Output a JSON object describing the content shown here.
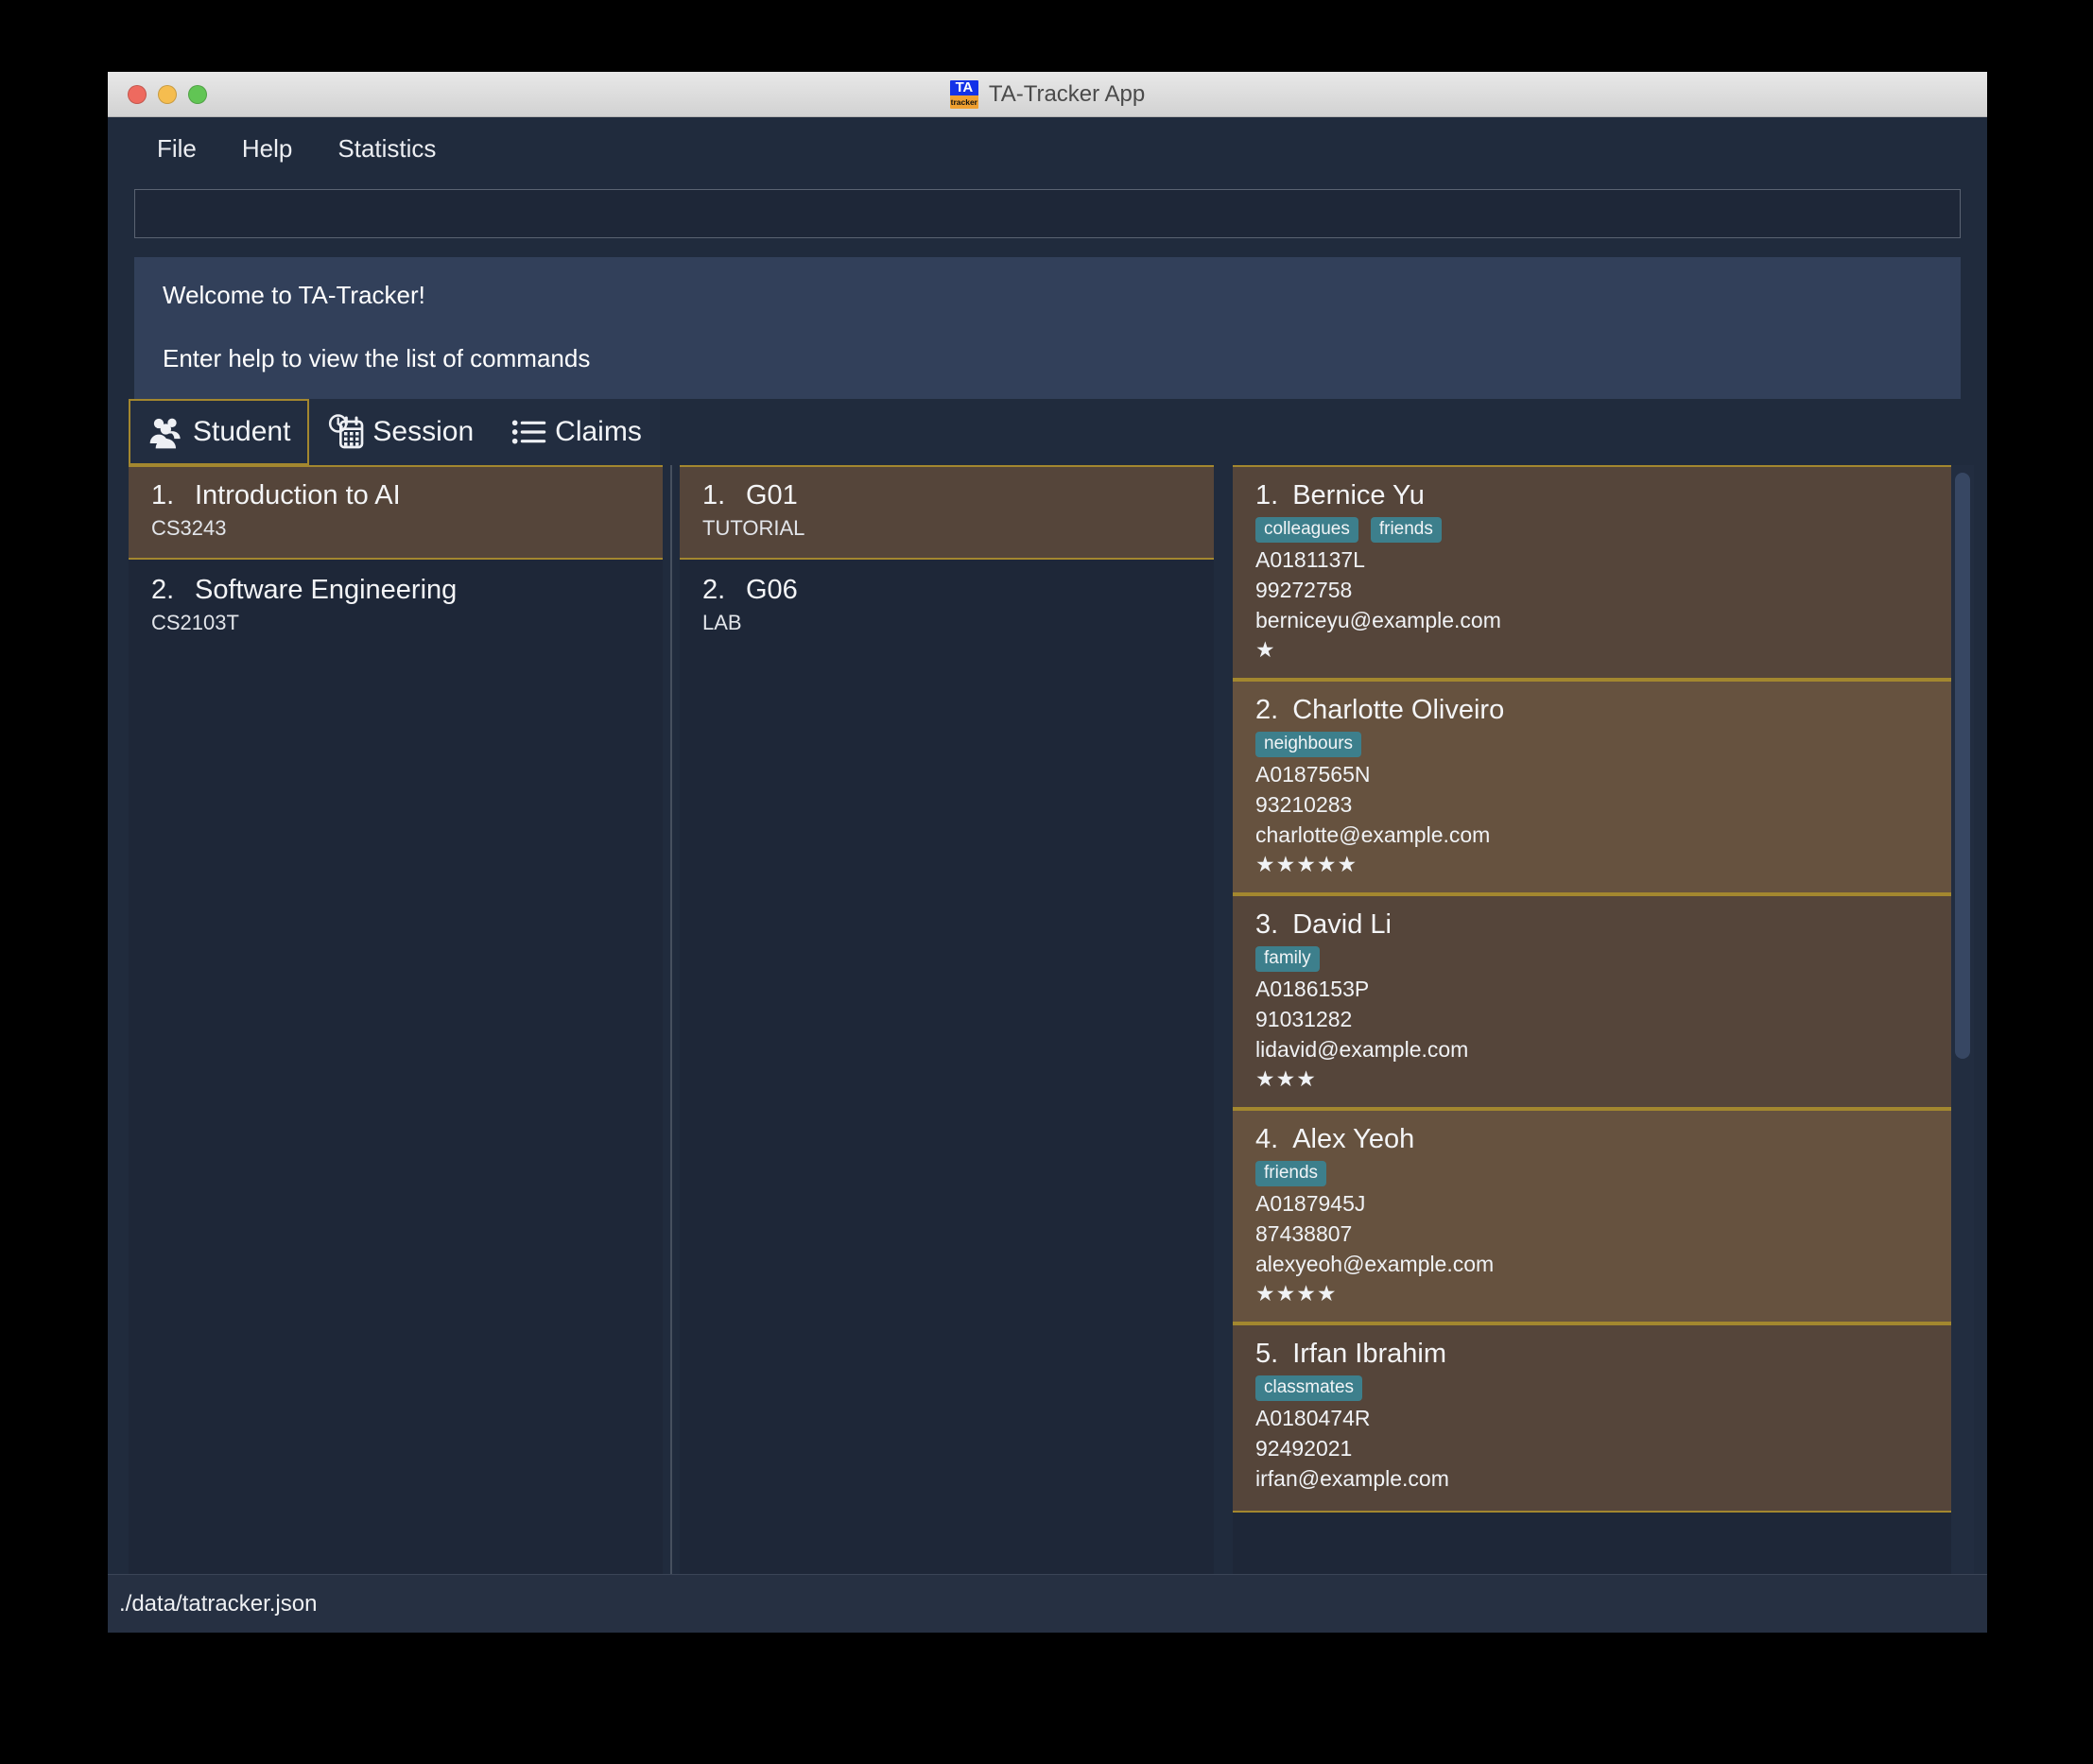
{
  "window": {
    "title": "TA-Tracker App",
    "app_icon": {
      "name": "ta-tracker-logo",
      "top_text": "TA",
      "bottom_text": "tracker"
    },
    "traffic_lights": [
      "close",
      "minimize",
      "maximize"
    ]
  },
  "menubar": {
    "items": [
      {
        "label": "File",
        "name": "menu-file"
      },
      {
        "label": "Help",
        "name": "menu-help"
      },
      {
        "label": "Statistics",
        "name": "menu-statistics"
      }
    ]
  },
  "command_box": {
    "value": "",
    "placeholder": ""
  },
  "result_display": {
    "lines": [
      "Welcome to TA-Tracker!",
      "Enter help to view the list of commands"
    ]
  },
  "tabs": [
    {
      "label": "Student",
      "icon": "people-group-icon",
      "selected": true
    },
    {
      "label": "Session",
      "icon": "clock-calendar-icon",
      "selected": false
    },
    {
      "label": "Claims",
      "icon": "list-bullets-icon",
      "selected": false
    }
  ],
  "modules": [
    {
      "index": "1.",
      "name": "Introduction to AI",
      "code": "CS3243",
      "selected": true
    },
    {
      "index": "2.",
      "name": "Software Engineering",
      "code": "CS2103T",
      "selected": false
    }
  ],
  "groups": [
    {
      "index": "1.",
      "name": "G01",
      "type": "TUTORIAL",
      "selected": true
    },
    {
      "index": "2.",
      "name": "G06",
      "type": "LAB",
      "selected": false
    }
  ],
  "students": [
    {
      "index": "1.",
      "name": "Bernice Yu",
      "tags": [
        "colleagues",
        "friends"
      ],
      "matric": "A0181137L",
      "phone": "99272758",
      "email": "berniceyu@example.com",
      "rating": "★"
    },
    {
      "index": "2.",
      "name": "Charlotte Oliveiro",
      "tags": [
        "neighbours"
      ],
      "matric": "A0187565N",
      "phone": "93210283",
      "email": "charlotte@example.com",
      "rating": "★★★★★"
    },
    {
      "index": "3.",
      "name": "David Li",
      "tags": [
        "family"
      ],
      "matric": "A0186153P",
      "phone": "91031282",
      "email": "lidavid@example.com",
      "rating": "★★★"
    },
    {
      "index": "4.",
      "name": "Alex Yeoh",
      "tags": [
        "friends"
      ],
      "matric": "A0187945J",
      "phone": "87438807",
      "email": "alexyeoh@example.com",
      "rating": "★★★★"
    },
    {
      "index": "5.",
      "name": "Irfan Ibrahim",
      "tags": [
        "classmates"
      ],
      "matric": "A0180474R",
      "phone": "92492021",
      "email": "irfan@example.com",
      "rating": ""
    }
  ],
  "statusbar": {
    "path": "./data/tatracker.json"
  },
  "colors": {
    "window_bg": "#202b3d",
    "panel_bg": "#1e2738",
    "result_bg": "#32405a",
    "selected_cell": "#55453a",
    "selected_border": "#a3872f",
    "tag_bg": "#3d7f8c",
    "text": "#f2f4f7"
  }
}
